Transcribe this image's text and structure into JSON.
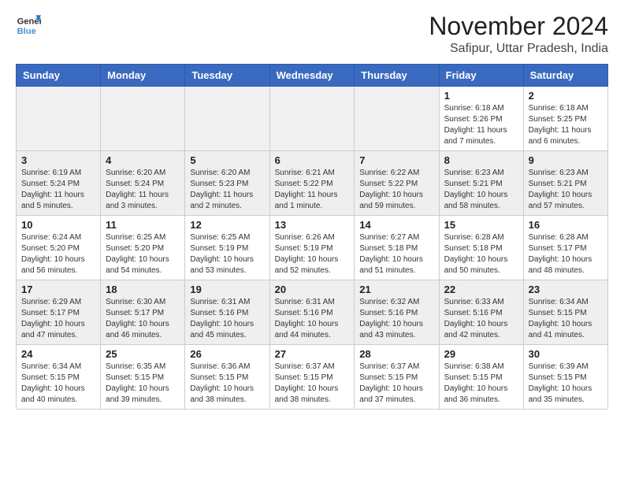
{
  "header": {
    "logo_line1": "General",
    "logo_line2": "Blue",
    "month": "November 2024",
    "location": "Safipur, Uttar Pradesh, India"
  },
  "weekdays": [
    "Sunday",
    "Monday",
    "Tuesday",
    "Wednesday",
    "Thursday",
    "Friday",
    "Saturday"
  ],
  "weeks": [
    [
      {
        "day": "",
        "info": ""
      },
      {
        "day": "",
        "info": ""
      },
      {
        "day": "",
        "info": ""
      },
      {
        "day": "",
        "info": ""
      },
      {
        "day": "",
        "info": ""
      },
      {
        "day": "1",
        "info": "Sunrise: 6:18 AM\nSunset: 5:26 PM\nDaylight: 11 hours and 7 minutes."
      },
      {
        "day": "2",
        "info": "Sunrise: 6:18 AM\nSunset: 5:25 PM\nDaylight: 11 hours and 6 minutes."
      }
    ],
    [
      {
        "day": "3",
        "info": "Sunrise: 6:19 AM\nSunset: 5:24 PM\nDaylight: 11 hours and 5 minutes."
      },
      {
        "day": "4",
        "info": "Sunrise: 6:20 AM\nSunset: 5:24 PM\nDaylight: 11 hours and 3 minutes."
      },
      {
        "day": "5",
        "info": "Sunrise: 6:20 AM\nSunset: 5:23 PM\nDaylight: 11 hours and 2 minutes."
      },
      {
        "day": "6",
        "info": "Sunrise: 6:21 AM\nSunset: 5:22 PM\nDaylight: 11 hours and 1 minute."
      },
      {
        "day": "7",
        "info": "Sunrise: 6:22 AM\nSunset: 5:22 PM\nDaylight: 10 hours and 59 minutes."
      },
      {
        "day": "8",
        "info": "Sunrise: 6:23 AM\nSunset: 5:21 PM\nDaylight: 10 hours and 58 minutes."
      },
      {
        "day": "9",
        "info": "Sunrise: 6:23 AM\nSunset: 5:21 PM\nDaylight: 10 hours and 57 minutes."
      }
    ],
    [
      {
        "day": "10",
        "info": "Sunrise: 6:24 AM\nSunset: 5:20 PM\nDaylight: 10 hours and 56 minutes."
      },
      {
        "day": "11",
        "info": "Sunrise: 6:25 AM\nSunset: 5:20 PM\nDaylight: 10 hours and 54 minutes."
      },
      {
        "day": "12",
        "info": "Sunrise: 6:25 AM\nSunset: 5:19 PM\nDaylight: 10 hours and 53 minutes."
      },
      {
        "day": "13",
        "info": "Sunrise: 6:26 AM\nSunset: 5:19 PM\nDaylight: 10 hours and 52 minutes."
      },
      {
        "day": "14",
        "info": "Sunrise: 6:27 AM\nSunset: 5:18 PM\nDaylight: 10 hours and 51 minutes."
      },
      {
        "day": "15",
        "info": "Sunrise: 6:28 AM\nSunset: 5:18 PM\nDaylight: 10 hours and 50 minutes."
      },
      {
        "day": "16",
        "info": "Sunrise: 6:28 AM\nSunset: 5:17 PM\nDaylight: 10 hours and 48 minutes."
      }
    ],
    [
      {
        "day": "17",
        "info": "Sunrise: 6:29 AM\nSunset: 5:17 PM\nDaylight: 10 hours and 47 minutes."
      },
      {
        "day": "18",
        "info": "Sunrise: 6:30 AM\nSunset: 5:17 PM\nDaylight: 10 hours and 46 minutes."
      },
      {
        "day": "19",
        "info": "Sunrise: 6:31 AM\nSunset: 5:16 PM\nDaylight: 10 hours and 45 minutes."
      },
      {
        "day": "20",
        "info": "Sunrise: 6:31 AM\nSunset: 5:16 PM\nDaylight: 10 hours and 44 minutes."
      },
      {
        "day": "21",
        "info": "Sunrise: 6:32 AM\nSunset: 5:16 PM\nDaylight: 10 hours and 43 minutes."
      },
      {
        "day": "22",
        "info": "Sunrise: 6:33 AM\nSunset: 5:16 PM\nDaylight: 10 hours and 42 minutes."
      },
      {
        "day": "23",
        "info": "Sunrise: 6:34 AM\nSunset: 5:15 PM\nDaylight: 10 hours and 41 minutes."
      }
    ],
    [
      {
        "day": "24",
        "info": "Sunrise: 6:34 AM\nSunset: 5:15 PM\nDaylight: 10 hours and 40 minutes."
      },
      {
        "day": "25",
        "info": "Sunrise: 6:35 AM\nSunset: 5:15 PM\nDaylight: 10 hours and 39 minutes."
      },
      {
        "day": "26",
        "info": "Sunrise: 6:36 AM\nSunset: 5:15 PM\nDaylight: 10 hours and 38 minutes."
      },
      {
        "day": "27",
        "info": "Sunrise: 6:37 AM\nSunset: 5:15 PM\nDaylight: 10 hours and 38 minutes."
      },
      {
        "day": "28",
        "info": "Sunrise: 6:37 AM\nSunset: 5:15 PM\nDaylight: 10 hours and 37 minutes."
      },
      {
        "day": "29",
        "info": "Sunrise: 6:38 AM\nSunset: 5:15 PM\nDaylight: 10 hours and 36 minutes."
      },
      {
        "day": "30",
        "info": "Sunrise: 6:39 AM\nSunset: 5:15 PM\nDaylight: 10 hours and 35 minutes."
      }
    ]
  ]
}
